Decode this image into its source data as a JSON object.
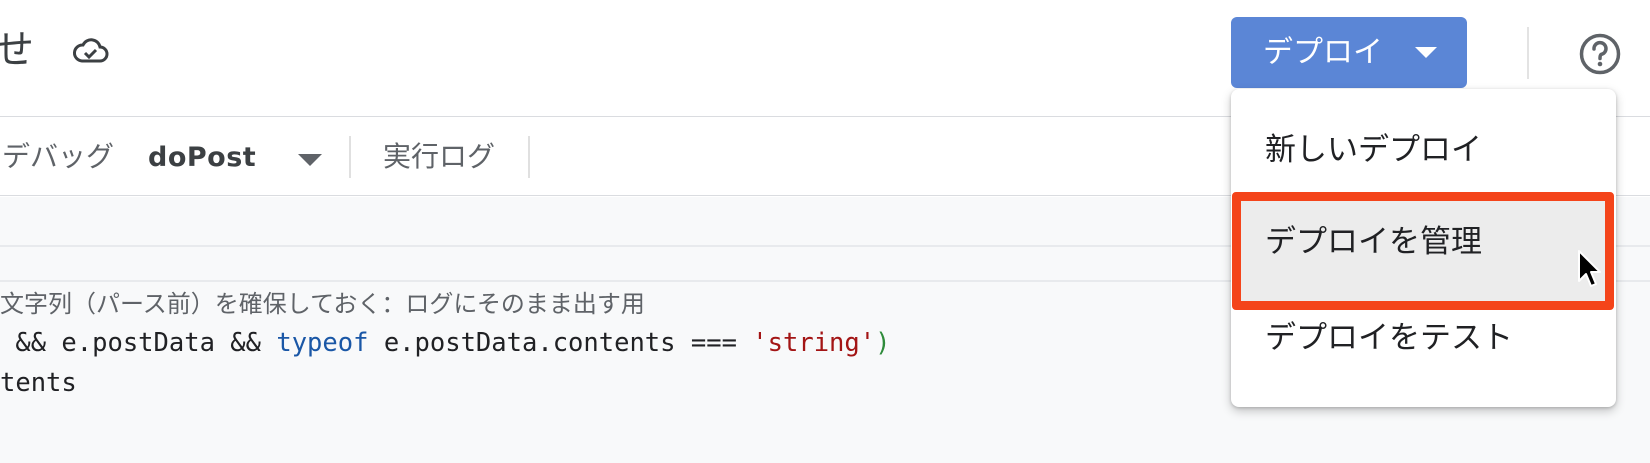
{
  "header": {
    "title_fragment": "せ",
    "cloud_icon": "cloud-check-icon",
    "deploy_button_label": "デプロイ",
    "help_icon": "help-circle-icon"
  },
  "toolbar": {
    "debug_label": "デバッグ",
    "function_select_value": "doPost",
    "execution_log_label": "実行ログ"
  },
  "editor": {
    "line1_text": "文字列（パース前）を確保しておく：ログにそのまま出す用",
    "line2": {
      "prefix": " && e.postData && ",
      "keyword": "typeof",
      "middle": " e.postData.contents === ",
      "string": "'string'",
      "paren": ")"
    },
    "line3_text": "tents"
  },
  "deploy_menu": {
    "items": [
      {
        "label": "新しいデプロイ"
      },
      {
        "label": "デプロイを管理"
      },
      {
        "label": "デプロイをテスト"
      }
    ],
    "highlight_color": "#f4441a"
  },
  "colors": {
    "deploy_button": "#5b86d6",
    "keyword": "#1a57a6",
    "string": "#a31515"
  }
}
